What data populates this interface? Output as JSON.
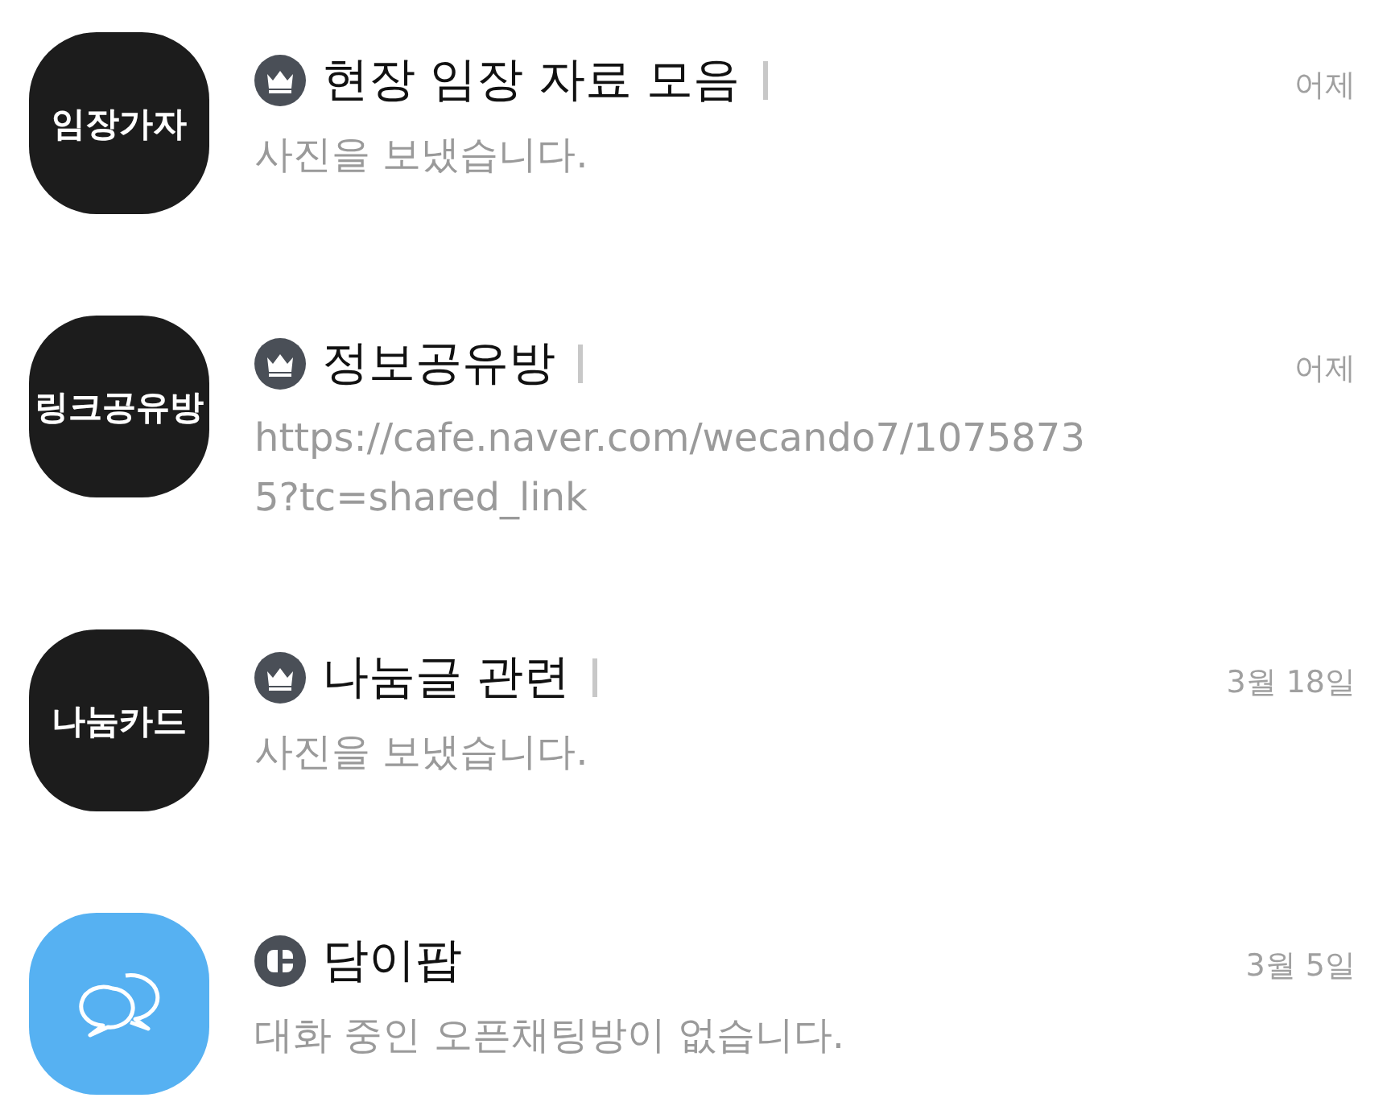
{
  "chats": [
    {
      "avatar": {
        "kind": "text",
        "label": "임장가자"
      },
      "badge": {
        "kind": "crown"
      },
      "title": "현장 임장 자료 모음",
      "member_bar": true,
      "message": "사진을 보냈습니다.",
      "time": "어제"
    },
    {
      "avatar": {
        "kind": "text",
        "label": "링크공유방"
      },
      "badge": {
        "kind": "crown"
      },
      "title": "정보공유방",
      "member_bar": true,
      "message": "https://cafe.naver.com/wecando7/10758735?tc=shared_link",
      "time": "어제"
    },
    {
      "avatar": {
        "kind": "text",
        "label": "나눔카드"
      },
      "badge": {
        "kind": "crown"
      },
      "title": "나눔글 관련",
      "member_bar": true,
      "message": "사진을 보냈습니다.",
      "time": "3월 18일"
    },
    {
      "avatar": {
        "kind": "chat"
      },
      "badge": {
        "kind": "card"
      },
      "title": "담이팝",
      "member_bar": false,
      "message": "대화 중인 오픈채팅방이 없습니다.",
      "time": "3월 5일"
    }
  ]
}
